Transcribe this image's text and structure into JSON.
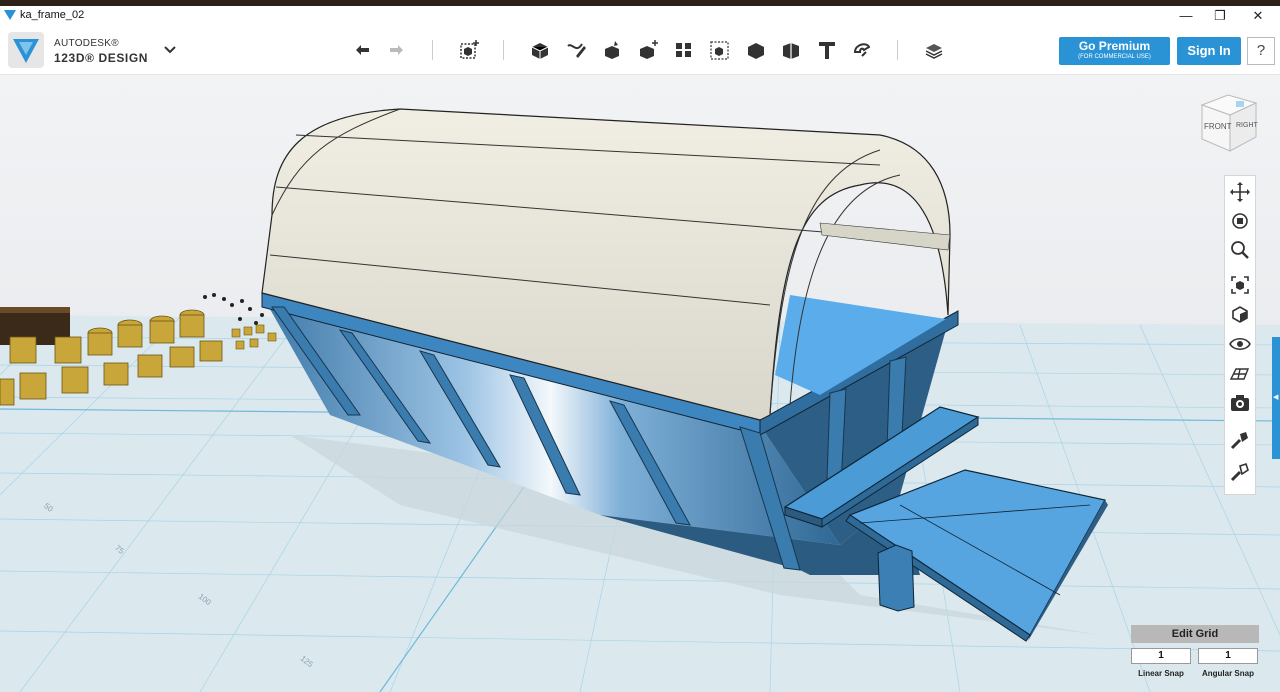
{
  "window": {
    "title": "ka_frame_02",
    "minimize_glyph": "—",
    "maximize_glyph": "❐",
    "close_glyph": "✕"
  },
  "brand": {
    "line1": "AUTODESK®",
    "line2": "123D® DESIGN"
  },
  "toolbar": {
    "tools": [
      "undo-icon",
      "redo-icon",
      "primitives-icon",
      "sketch-icon",
      "construct-icon",
      "modify-icon",
      "pattern-icon",
      "group-icon",
      "combine-icon",
      "measure-icon",
      "text-icon",
      "snap-icon",
      "material-icon"
    ],
    "premium_label": "Go Premium",
    "premium_sub": "(FOR COMMERCIAL USE)",
    "signin_label": "Sign In",
    "help_label": "?"
  },
  "viewcube": {
    "front": "FRONT",
    "right": "RIGHT"
  },
  "nav_tools": [
    "pan-icon",
    "orbit-icon",
    "zoom-icon",
    "fit-icon",
    "views-icon",
    "visibility-icon",
    "grid-material-icon",
    "screenshot-icon",
    "materials-icon",
    "outliner-icon"
  ],
  "grid": {
    "edit_label": "Edit Grid",
    "linear_snap_value": "1",
    "angular_snap_value": "1",
    "linear_snap_label": "Linear Snap",
    "angular_snap_label": "Angular Snap",
    "tick_labels": [
      "50",
      "75",
      "100",
      "125"
    ]
  },
  "colors": {
    "accent": "#2a93d5",
    "model_blue": "#3a7cae",
    "roof": "#ece9dc"
  }
}
